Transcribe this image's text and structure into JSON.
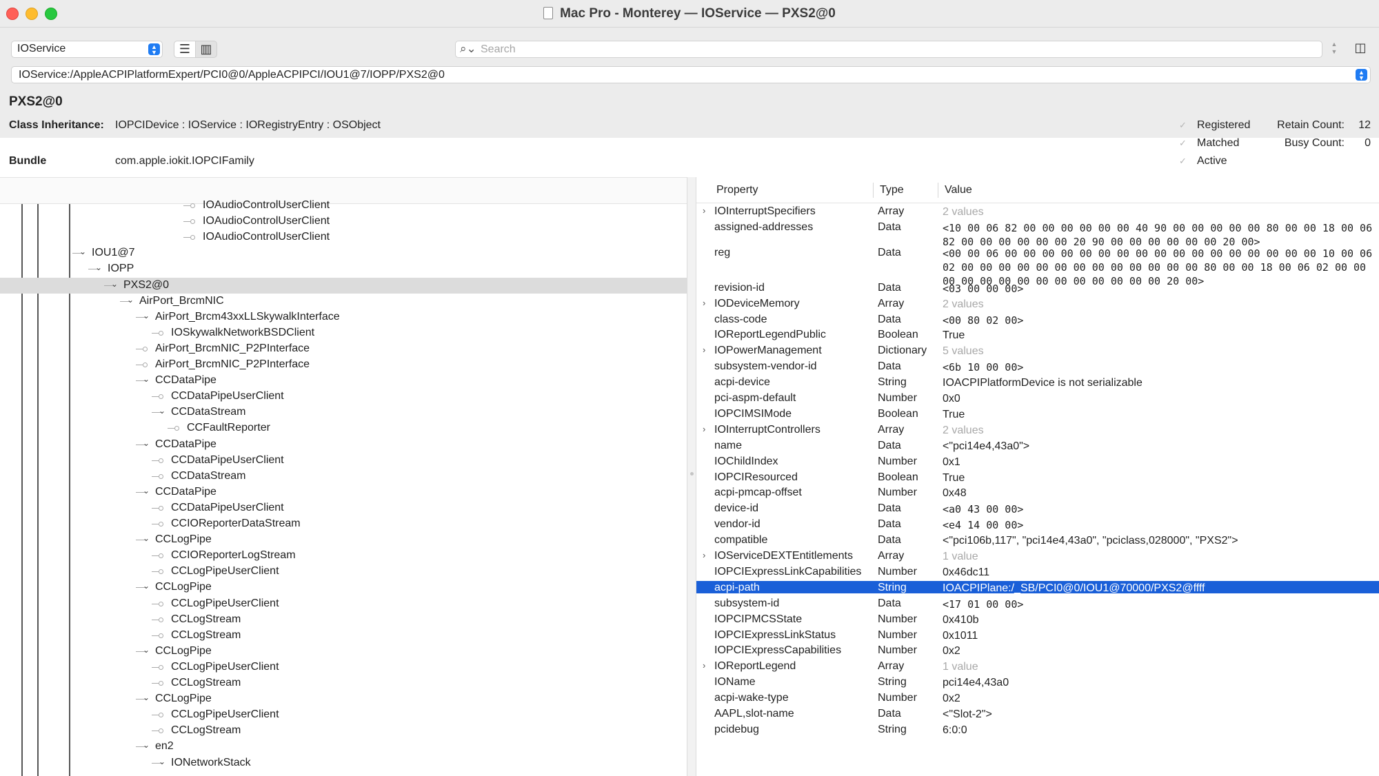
{
  "window": {
    "title": "Mac Pro - Monterey — IOService — PXS2@0"
  },
  "toolbar": {
    "plane": "IOService",
    "search_placeholder": "Search",
    "path": "IOService:/AppleACPIPlatformExpert/PCI0@0/AppleACPIPCI/IOU1@7/IOPP/PXS2@0"
  },
  "info": {
    "name": "PXS2@0",
    "class_label": "Class Inheritance:",
    "class_value": "IOPCIDevice : IOService : IORegistryEntry : OSObject",
    "bundle_label": "Bundle",
    "bundle_value": "com.apple.iokit.IOPCIFamily",
    "flags": [
      "Registered",
      "Matched",
      "Active"
    ],
    "retain_label": "Retain Count:",
    "retain_value": "12",
    "busy_label": "Busy Count:",
    "busy_value": "0"
  },
  "tree": [
    {
      "label": "IOAudioControlUserClient",
      "indent": 12,
      "disc": "",
      "selected": false
    },
    {
      "label": "IOAudioControlUserClient",
      "indent": 12,
      "disc": "",
      "selected": false
    },
    {
      "label": "IOAudioControlUserClient",
      "indent": 12,
      "disc": "",
      "selected": false
    },
    {
      "label": "IOU1@7",
      "indent": 5,
      "disc": "down",
      "selected": false
    },
    {
      "label": "IOPP",
      "indent": 6,
      "disc": "down",
      "selected": false
    },
    {
      "label": "PXS2@0",
      "indent": 7,
      "disc": "down",
      "selected": true
    },
    {
      "label": "AirPort_BrcmNIC",
      "indent": 8,
      "disc": "down",
      "selected": false
    },
    {
      "label": "AirPort_Brcm43xxLLSkywalkInterface",
      "indent": 9,
      "disc": "down",
      "selected": false
    },
    {
      "label": "IOSkywalkNetworkBSDClient",
      "indent": 10,
      "disc": "",
      "selected": false
    },
    {
      "label": "AirPort_BrcmNIC_P2PInterface",
      "indent": 9,
      "disc": "",
      "selected": false
    },
    {
      "label": "AirPort_BrcmNIC_P2PInterface",
      "indent": 9,
      "disc": "",
      "selected": false
    },
    {
      "label": "CCDataPipe",
      "indent": 9,
      "disc": "down",
      "selected": false
    },
    {
      "label": "CCDataPipeUserClient",
      "indent": 10,
      "disc": "",
      "selected": false
    },
    {
      "label": "CCDataStream",
      "indent": 10,
      "disc": "down",
      "selected": false
    },
    {
      "label": "CCFaultReporter",
      "indent": 11,
      "disc": "",
      "selected": false
    },
    {
      "label": "CCDataPipe",
      "indent": 9,
      "disc": "down",
      "selected": false
    },
    {
      "label": "CCDataPipeUserClient",
      "indent": 10,
      "disc": "",
      "selected": false
    },
    {
      "label": "CCDataStream",
      "indent": 10,
      "disc": "",
      "selected": false
    },
    {
      "label": "CCDataPipe",
      "indent": 9,
      "disc": "down",
      "selected": false
    },
    {
      "label": "CCDataPipeUserClient",
      "indent": 10,
      "disc": "",
      "selected": false
    },
    {
      "label": "CCIOReporterDataStream",
      "indent": 10,
      "disc": "",
      "selected": false
    },
    {
      "label": "CCLogPipe",
      "indent": 9,
      "disc": "down",
      "selected": false
    },
    {
      "label": "CCIOReporterLogStream",
      "indent": 10,
      "disc": "",
      "selected": false
    },
    {
      "label": "CCLogPipeUserClient",
      "indent": 10,
      "disc": "",
      "selected": false
    },
    {
      "label": "CCLogPipe",
      "indent": 9,
      "disc": "down",
      "selected": false
    },
    {
      "label": "CCLogPipeUserClient",
      "indent": 10,
      "disc": "",
      "selected": false
    },
    {
      "label": "CCLogStream",
      "indent": 10,
      "disc": "",
      "selected": false
    },
    {
      "label": "CCLogStream",
      "indent": 10,
      "disc": "",
      "selected": false
    },
    {
      "label": "CCLogPipe",
      "indent": 9,
      "disc": "down",
      "selected": false
    },
    {
      "label": "CCLogPipeUserClient",
      "indent": 10,
      "disc": "",
      "selected": false
    },
    {
      "label": "CCLogStream",
      "indent": 10,
      "disc": "",
      "selected": false
    },
    {
      "label": "CCLogPipe",
      "indent": 9,
      "disc": "down",
      "selected": false
    },
    {
      "label": "CCLogPipeUserClient",
      "indent": 10,
      "disc": "",
      "selected": false
    },
    {
      "label": "CCLogStream",
      "indent": 10,
      "disc": "",
      "selected": false
    },
    {
      "label": "en2",
      "indent": 9,
      "disc": "down",
      "selected": false
    },
    {
      "label": "IONetworkStack",
      "indent": 10,
      "disc": "down",
      "selected": false
    }
  ],
  "props": {
    "columns": {
      "property": "Property",
      "type": "Type",
      "value": "Value"
    },
    "rows": [
      {
        "name": "IOInterruptSpecifiers",
        "type": "Array",
        "value": "2 values",
        "expandable": true,
        "muted": true,
        "mono": false,
        "lines": 1,
        "selected": false
      },
      {
        "name": "assigned-addresses",
        "type": "Data",
        "value": "<10 00 06 82 00 00 00 00 00 00 40 90 00 00 00 00 00 80 00 00 18 00 06 82 00 00 00 00 00 00 20 90 00 00 00 00 00 00 20 00>",
        "expandable": false,
        "muted": false,
        "mono": true,
        "lines": 2,
        "selected": false
      },
      {
        "name": "reg",
        "type": "Data",
        "value": "<00 00 06 00 00 00 00 00 00 00 00 00 00 00 00 00 00 00 00 00 10 00 06 02 00 00 00 00 00 00 00 00 00 00 00 00 00 80 00 00 18 00 06 02 00 00 00 00 00 00 00 00 00 00 00 00 00 00 20 00>",
        "expandable": false,
        "muted": false,
        "mono": true,
        "lines": 3,
        "selected": false
      },
      {
        "name": "revision-id",
        "type": "Data",
        "value": "<03 00 00 00>",
        "expandable": false,
        "muted": false,
        "mono": true,
        "lines": 1,
        "selected": false
      },
      {
        "name": "IODeviceMemory",
        "type": "Array",
        "value": "2 values",
        "expandable": true,
        "muted": true,
        "mono": false,
        "lines": 1,
        "selected": false
      },
      {
        "name": "class-code",
        "type": "Data",
        "value": "<00 80 02 00>",
        "expandable": false,
        "muted": false,
        "mono": true,
        "lines": 1,
        "selected": false
      },
      {
        "name": "IOReportLegendPublic",
        "type": "Boolean",
        "value": "True",
        "expandable": false,
        "muted": false,
        "mono": false,
        "lines": 1,
        "selected": false
      },
      {
        "name": "IOPowerManagement",
        "type": "Dictionary",
        "value": "5 values",
        "expandable": true,
        "muted": true,
        "mono": false,
        "lines": 1,
        "selected": false
      },
      {
        "name": "subsystem-vendor-id",
        "type": "Data",
        "value": "<6b 10 00 00>",
        "expandable": false,
        "muted": false,
        "mono": true,
        "lines": 1,
        "selected": false
      },
      {
        "name": "acpi-device",
        "type": "String",
        "value": "IOACPIPlatformDevice is not serializable",
        "expandable": false,
        "muted": false,
        "mono": false,
        "lines": 1,
        "selected": false
      },
      {
        "name": "pci-aspm-default",
        "type": "Number",
        "value": "0x0",
        "expandable": false,
        "muted": false,
        "mono": false,
        "lines": 1,
        "selected": false
      },
      {
        "name": "IOPCIMSIMode",
        "type": "Boolean",
        "value": "True",
        "expandable": false,
        "muted": false,
        "mono": false,
        "lines": 1,
        "selected": false
      },
      {
        "name": "IOInterruptControllers",
        "type": "Array",
        "value": "2 values",
        "expandable": true,
        "muted": true,
        "mono": false,
        "lines": 1,
        "selected": false
      },
      {
        "name": "name",
        "type": "Data",
        "value": "<\"pci14e4,43a0\">",
        "expandable": false,
        "muted": false,
        "mono": false,
        "lines": 1,
        "selected": false
      },
      {
        "name": "IOChildIndex",
        "type": "Number",
        "value": "0x1",
        "expandable": false,
        "muted": false,
        "mono": false,
        "lines": 1,
        "selected": false
      },
      {
        "name": "IOPCIResourced",
        "type": "Boolean",
        "value": "True",
        "expandable": false,
        "muted": false,
        "mono": false,
        "lines": 1,
        "selected": false
      },
      {
        "name": "acpi-pmcap-offset",
        "type": "Number",
        "value": "0x48",
        "expandable": false,
        "muted": false,
        "mono": false,
        "lines": 1,
        "selected": false
      },
      {
        "name": "device-id",
        "type": "Data",
        "value": "<a0 43 00 00>",
        "expandable": false,
        "muted": false,
        "mono": true,
        "lines": 1,
        "selected": false
      },
      {
        "name": "vendor-id",
        "type": "Data",
        "value": "<e4 14 00 00>",
        "expandable": false,
        "muted": false,
        "mono": true,
        "lines": 1,
        "selected": false
      },
      {
        "name": "compatible",
        "type": "Data",
        "value": "<\"pci106b,117\", \"pci14e4,43a0\", \"pciclass,028000\", \"PXS2\">",
        "expandable": false,
        "muted": false,
        "mono": false,
        "lines": 1,
        "selected": false
      },
      {
        "name": "IOServiceDEXTEntitlements",
        "type": "Array",
        "value": "1 value",
        "expandable": true,
        "muted": true,
        "mono": false,
        "lines": 1,
        "selected": false
      },
      {
        "name": "IOPCIExpressLinkCapabilities",
        "type": "Number",
        "value": "0x46dc11",
        "expandable": false,
        "muted": false,
        "mono": false,
        "lines": 1,
        "selected": false
      },
      {
        "name": "acpi-path",
        "type": "String",
        "value": "IOACPIPlane:/_SB/PCI0@0/IOU1@70000/PXS2@ffff",
        "expandable": false,
        "muted": false,
        "mono": false,
        "lines": 1,
        "selected": true
      },
      {
        "name": "subsystem-id",
        "type": "Data",
        "value": "<17 01 00 00>",
        "expandable": false,
        "muted": false,
        "mono": true,
        "lines": 1,
        "selected": false
      },
      {
        "name": "IOPCIPMCSState",
        "type": "Number",
        "value": "0x410b",
        "expandable": false,
        "muted": false,
        "mono": false,
        "lines": 1,
        "selected": false
      },
      {
        "name": "IOPCIExpressLinkStatus",
        "type": "Number",
        "value": "0x1011",
        "expandable": false,
        "muted": false,
        "mono": false,
        "lines": 1,
        "selected": false
      },
      {
        "name": "IOPCIExpressCapabilities",
        "type": "Number",
        "value": "0x2",
        "expandable": false,
        "muted": false,
        "mono": false,
        "lines": 1,
        "selected": false
      },
      {
        "name": "IOReportLegend",
        "type": "Array",
        "value": "1 value",
        "expandable": true,
        "muted": true,
        "mono": false,
        "lines": 1,
        "selected": false
      },
      {
        "name": "IOName",
        "type": "String",
        "value": "pci14e4,43a0",
        "expandable": false,
        "muted": false,
        "mono": false,
        "lines": 1,
        "selected": false
      },
      {
        "name": "acpi-wake-type",
        "type": "Number",
        "value": "0x2",
        "expandable": false,
        "muted": false,
        "mono": false,
        "lines": 1,
        "selected": false
      },
      {
        "name": "AAPL,slot-name",
        "type": "Data",
        "value": "<\"Slot-2\">",
        "expandable": false,
        "muted": false,
        "mono": false,
        "lines": 1,
        "selected": false
      },
      {
        "name": "pcidebug",
        "type": "String",
        "value": "6:0:0",
        "expandable": false,
        "muted": false,
        "mono": false,
        "lines": 1,
        "selected": false
      }
    ]
  }
}
